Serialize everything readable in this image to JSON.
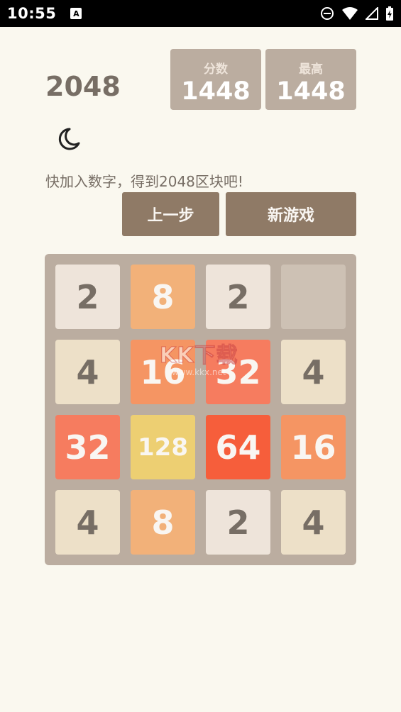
{
  "status_bar": {
    "time": "10:55",
    "notification_icon": "A"
  },
  "header": {
    "title": "2048",
    "score": {
      "label": "分数",
      "value": "1448"
    },
    "best": {
      "label": "最高",
      "value": "1448"
    }
  },
  "hint": "快加入数字，得到2048区块吧!",
  "buttons": {
    "undo": "上一步",
    "new_game": "新游戏"
  },
  "board": {
    "tiles": [
      [
        "2",
        "8",
        "2",
        ""
      ],
      [
        "4",
        "16",
        "32",
        "4"
      ],
      [
        "32",
        "128",
        "64",
        "16"
      ],
      [
        "4",
        "8",
        "2",
        "4"
      ]
    ]
  },
  "watermark": {
    "main": "KK下载",
    "url": "www.kkx.net"
  },
  "colors": {
    "background": "#faf8ef",
    "board": "#bbada0",
    "empty": "#cdc1b4",
    "tile_2": "#eee4da",
    "tile_4": "#ede0c8",
    "tile_8": "#f2b179",
    "tile_16": "#f59563",
    "tile_32": "#f67c5f",
    "tile_64": "#f65e3b",
    "tile_128": "#edcf72",
    "button": "#8f7a66"
  }
}
